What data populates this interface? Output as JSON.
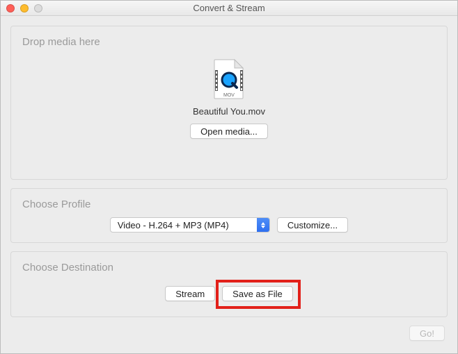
{
  "window": {
    "title": "Convert & Stream"
  },
  "drop": {
    "heading": "Drop media here",
    "file_name": "Beautiful You.mov",
    "file_ext_label": "MOV",
    "open_button": "Open media..."
  },
  "profile": {
    "heading": "Choose Profile",
    "selected": "Video - H.264 + MP3 (MP4)",
    "customize_button": "Customize..."
  },
  "destination": {
    "heading": "Choose Destination",
    "stream_button": "Stream",
    "save_button": "Save as File"
  },
  "footer": {
    "go_button": "Go!"
  },
  "colors": {
    "highlight": "#e2201a",
    "window_bg": "#ececec",
    "accent_blue": "#2e6ff0"
  }
}
